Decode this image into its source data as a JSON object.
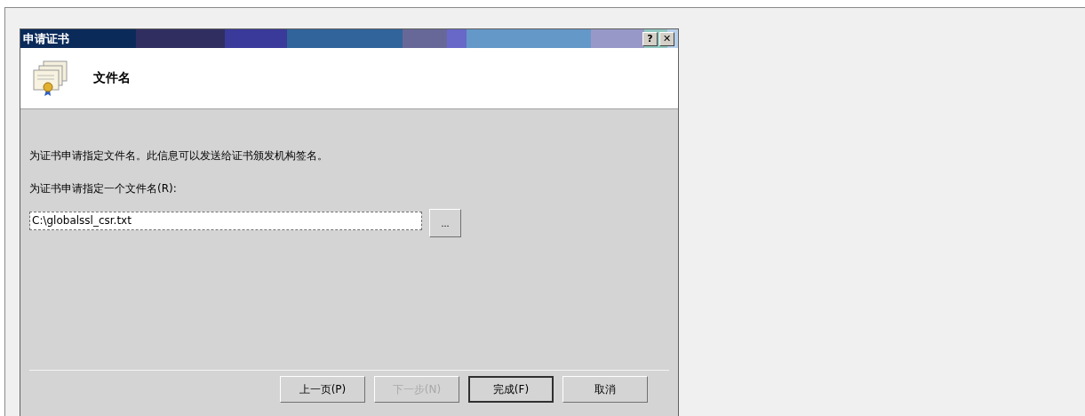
{
  "window": {
    "title": "申请证书",
    "help_button": "?",
    "close_button": "✕"
  },
  "header": {
    "title": "文件名"
  },
  "description": "为证书申请指定文件名。此信息可以发送给证书颁发机构签名。",
  "file_field": {
    "label": "为证书申请指定一个文件名(R):",
    "value": "C:\\globalssl_csr.txt",
    "browse_button": "..."
  },
  "buttons": [
    {
      "label": "上一页(P)",
      "disabled": false,
      "default": false
    },
    {
      "label": "下一步(N)",
      "disabled": true,
      "default": false
    },
    {
      "label": "完成(F)",
      "disabled": false,
      "default": true
    },
    {
      "label": "取消",
      "disabled": false,
      "default": false
    }
  ]
}
